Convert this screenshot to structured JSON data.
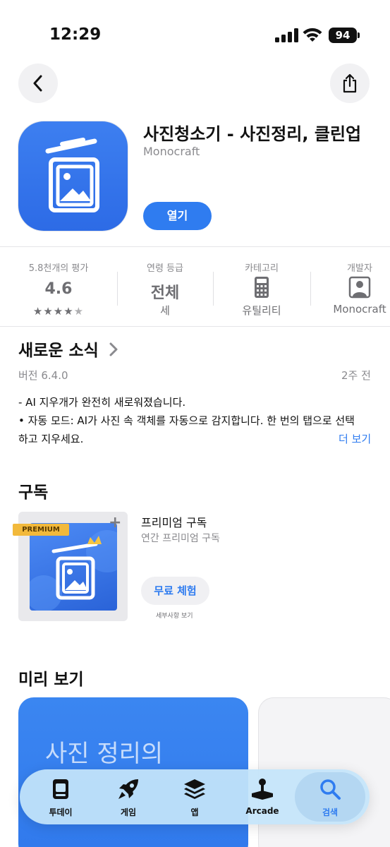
{
  "status_bar": {
    "time": "12:29",
    "battery": "94"
  },
  "app": {
    "title": "사진청소기 - 사진정리, 클린업",
    "developer": "Monocraft",
    "open_label": "열기"
  },
  "info": {
    "ratings_label": "5.8천개의 평가",
    "rating_value": "4.6",
    "rating_stars": 4.6,
    "age_label": "연령 등급",
    "age_value": "전체",
    "age_sub": "세",
    "category_label": "카테고리",
    "category_value": "유틸리티",
    "developer_label": "개발자",
    "developer_value": "Monocraft"
  },
  "whats_new": {
    "title": "새로운 소식",
    "version": "버전 6.4.0",
    "time_ago": "2주 전",
    "line1": "- AI 지우개가 완전히 새로워졌습니다.",
    "line2": "• 자동 모드: AI가 사진 속 객체를 자동으로 감지합니다. 한 번의 탭으로 선택",
    "line3": "하고 지우세요.",
    "more": "더 보기"
  },
  "subscription": {
    "title": "구독",
    "badge": "PREMIUM",
    "name": "프리미엄 구독",
    "description": "연간 프리미엄 구독",
    "trial_label": "무료 체험",
    "details_label": "세부사항 보기"
  },
  "preview": {
    "title": "미리 보기",
    "card_text": "사진 정리의"
  },
  "tab_bar": {
    "tabs": [
      {
        "label": "투데이",
        "icon": "today-icon"
      },
      {
        "label": "게임",
        "icon": "rocket-icon"
      },
      {
        "label": "앱",
        "icon": "apps-stack-icon"
      },
      {
        "label": "Arcade",
        "icon": "joystick-icon"
      },
      {
        "label": "검색",
        "icon": "search-icon"
      }
    ],
    "active": "검색"
  },
  "colors": {
    "accent": "#2f7cf0",
    "icon_bg": "#3575eb",
    "premium": "#f2b93b"
  }
}
